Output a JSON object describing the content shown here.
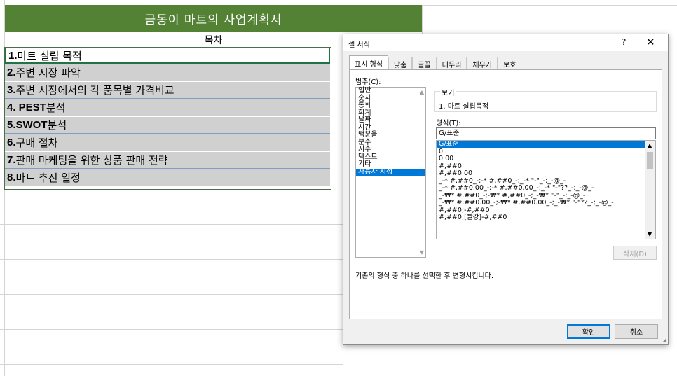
{
  "sheet": {
    "title": "금동이 마트의 사업계획서",
    "toc_header": "목차",
    "rows": [
      {
        "num": "1.",
        "text": " 마트 설립 목적"
      },
      {
        "num": "2.",
        "text": " 주변 시장 파악"
      },
      {
        "num": "3.",
        "text": " 주변 시장에서의 각 품목별 가격비교"
      },
      {
        "num": "4. PEST",
        "text": " 분석"
      },
      {
        "num": "5.SWOT",
        "text": " 분석"
      },
      {
        "num": "6.",
        "text": " 구매 절차"
      },
      {
        "num": "7.",
        "text": " 판매 마케팅을 위한 상품 판매 전략"
      },
      {
        "num": "8.",
        "text": " 마트 추진 일정"
      }
    ]
  },
  "dialog": {
    "title": "셀 서식",
    "help": "?",
    "close": "✕",
    "tabs": [
      "표시 형식",
      "맞춤",
      "글꼴",
      "테두리",
      "채우기",
      "보호"
    ],
    "active_tab": "표시 형식",
    "category_label": "범주(C):",
    "categories": [
      "일반",
      "숫자",
      "통화",
      "회계",
      "날짜",
      "시간",
      "백분율",
      "분수",
      "지수",
      "텍스트",
      "기타",
      "사용자 지정"
    ],
    "selected_category": "사용자 지정",
    "sample_label": "보기",
    "sample_value": "1. 마트 설립목적",
    "format_label": "형식(T):",
    "format_value": "G/표준",
    "formats": [
      "G/표준",
      "0",
      "0.00",
      "#,##0",
      "#,##0.00",
      "_-* #,##0_-;-* #,##0_-;_-* \"-\"_-;_-@_-",
      "_-* #,##0.00_-;-* #,##0.00_-;_-* \"-\"??_-;_-@_-",
      "_-₩* #,##0_-;-₩* #,##0_-;_-₩* \"-\"_-;_-@_-",
      "_-₩* #,##0.00_-;-₩* #,##0.00_-;_-₩* \"-\"??_-;_-@_-",
      "#,##0;-#,##0",
      "#,##0;[빨강]-#,##0"
    ],
    "selected_format": "G/표준",
    "delete_label": "삭제(D)",
    "description": "기존의 형식 중 하나를 선택한 후 변형시킵니다.",
    "ok_label": "확인",
    "cancel_label": "취소"
  },
  "colors": {
    "title_fill": "#548235",
    "row_fill": "#d0d0d0",
    "selection_blue": "#0078d7"
  }
}
